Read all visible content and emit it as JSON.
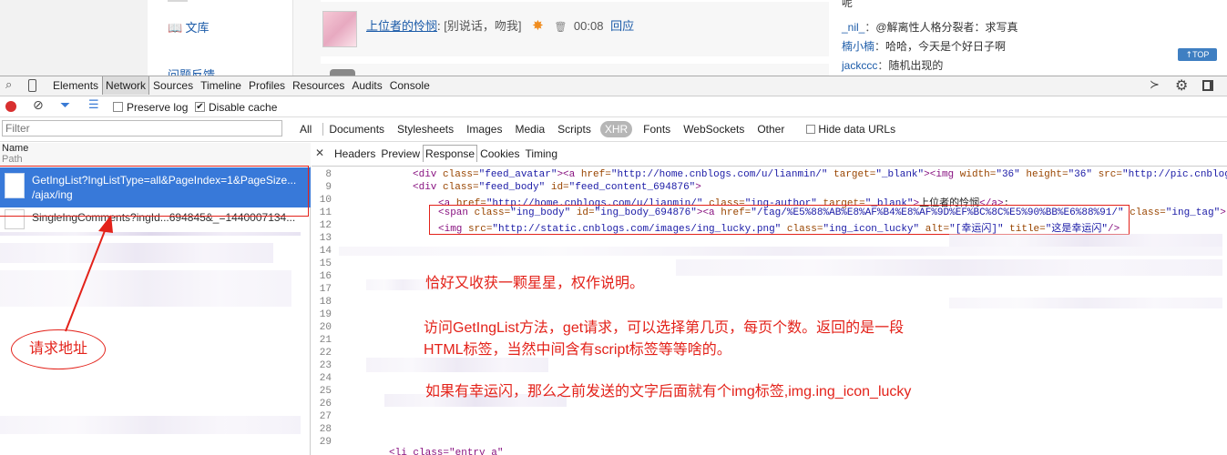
{
  "page": {
    "sidebar_link": "文库",
    "comment_author": "上位者的怜悯",
    "comment_text": "[别说话，吻我]",
    "comment_time": "00:08",
    "reply_label": "回应",
    "side_top_text": "呢",
    "side_items": [
      {
        "name": "_nil_",
        "text": "@解离性人格分裂者：求写真"
      },
      {
        "name": "楠小楠",
        "text": "哈哈，今天是个好日子啊"
      },
      {
        "name": "jackccc",
        "text": "随机出现的"
      }
    ],
    "top_button": "TOP",
    "cut_link": "问题反馈"
  },
  "devtools": {
    "tabs": [
      "Elements",
      "Network",
      "Sources",
      "Timeline",
      "Profiles",
      "Resources",
      "Audits",
      "Console"
    ],
    "active_tab": "Network",
    "preserve_log": "Preserve log",
    "disable_cache": "Disable cache",
    "filter_placeholder": "Filter",
    "type_filters": [
      "All",
      "Documents",
      "Stylesheets",
      "Images",
      "Media",
      "Scripts",
      "XHR",
      "Fonts",
      "WebSockets",
      "Other"
    ],
    "active_type": "XHR",
    "hide_data_urls": "Hide data URLs",
    "col_name": "Name",
    "col_path": "Path",
    "requests": [
      {
        "name": "GetIngList?IngListType=all&PageIndex=1&PageSize...",
        "path": "/ajax/ing"
      },
      {
        "name": "SingleIngComments?ingId...694845&_=1440007134...",
        "path": ""
      }
    ],
    "detail_tabs": [
      "Headers",
      "Preview",
      "Response",
      "Cookies",
      "Timing"
    ],
    "active_detail_tab": "Response",
    "line_numbers": [
      "8",
      "9",
      "10",
      "11",
      "12",
      "13",
      "14",
      "15",
      "16",
      "17",
      "18",
      "19",
      "20",
      "21",
      "22",
      "23",
      "24",
      "25",
      "26",
      "27",
      "28",
      "29"
    ],
    "code": {
      "l8_a": "<div ",
      "l8_b": "class=",
      "l8_c": "\"feed_avatar\"",
      "l8_d": "><a ",
      "l8_e": "href=",
      "l8_f": "\"http://home.cnblogs.com/u/lianmin/\"",
      "l8_g": " target=",
      "l8_h": "\"_blank\"",
      "l8_i": "><img ",
      "l8_j": "width=",
      "l8_k": "\"36\"",
      "l8_l": " height=",
      "l8_m": "\"36\"",
      "l8_n": " src=",
      "l8_o": "\"http://pic.cnblog",
      "l9_a": "<div ",
      "l9_b": "class=",
      "l9_c": "\"feed_body\"",
      "l9_d": " id=",
      "l9_e": "\"feed_content_694876\"",
      "l9_f": ">",
      "l10_a": "<a ",
      "l10_b": "href=",
      "l10_c": "\"http://home.cnblogs.com/u/lianmin/\"",
      "l10_d": " class=",
      "l10_e": "\"ing-author\"",
      "l10_f": " target=",
      "l10_g": "\"_blank\"",
      "l10_h": ">",
      "l10_i": "上位者的怜悯",
      "l10_j": "</a>",
      "l10_k": ":",
      "l11_a": "<span ",
      "l11_b": "class=",
      "l11_c": "\"ing_body\"",
      "l11_d": " id=",
      "l11_e": "\"ing_body_694876\"",
      "l11_f": "><a ",
      "l11_g": "href=",
      "l11_h": "\"/tag/%E5%88%AB%E8%AF%B4%E8%AF%9D%EF%BC%8C%E5%90%BB%E6%88%91/\"",
      "l11_i": " class=",
      "l11_j": "\"ing_tag\"",
      "l11_k": ">",
      "l12_a": "<img ",
      "l12_b": "src=",
      "l12_c": "\"http://static.cnblogs.com/images/ing_lucky.png\"",
      "l12_d": " class=",
      "l12_e": "\"ing_icon_lucky\"",
      "l12_f": " alt=",
      "l12_g": "\"[幸运闪]\"",
      "l12_h": " title=",
      "l12_i": "\"这是幸运闪\"",
      "l12_j": "/>",
      "last_line": "<li class=\"entry_a\""
    }
  },
  "annotations": {
    "left_label": "请求地址",
    "note1": "恰好又收获一颗星星，权作说明。",
    "note2_l1": "访问GetIngList方法，get请求，可以选择第几页，每页个数。返回的是一段",
    "note2_l2": "HTML标签，当然中间含有script标签等等啥的。",
    "note3": "如果有幸运闪，那么之前发送的文字后面就有个img标签,img.ing_icon_lucky"
  },
  "colors": {
    "annotation_red": "#e3221a",
    "selected_row": "#3879d9",
    "devtools_toolbar": "#f3f3f3"
  }
}
